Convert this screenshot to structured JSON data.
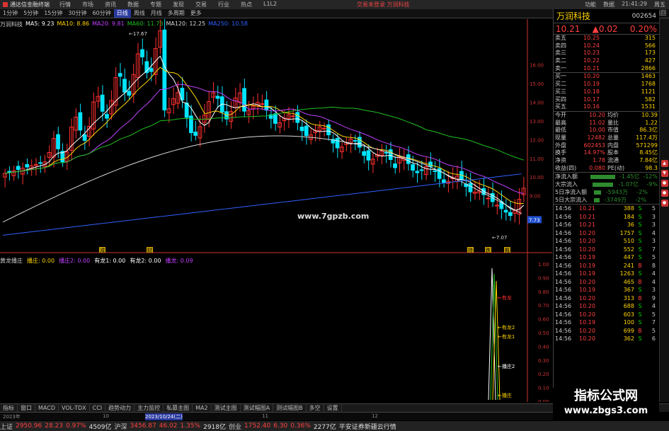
{
  "titlebar": {
    "app": "通达信金融终端",
    "menu": [
      "行情",
      "市场",
      "资讯",
      "数据",
      "专题",
      "发现",
      "交易",
      "行业",
      "热点",
      "L1L2"
    ],
    "promo": "交易未登录  万润科技",
    "right": [
      "功能",
      "数据",
      "21:41:29",
      "周五"
    ]
  },
  "toolbar": {
    "items": [
      "1分钟",
      "5分钟",
      "15分钟",
      "30分钟",
      "60分钟",
      "日线",
      "周线",
      "月线",
      "多周期",
      "更多"
    ],
    "active": "日线",
    "right": [
      "F10",
      "标记",
      "返回"
    ]
  },
  "chart": {
    "stock_label": "万润科技",
    "ma": [
      {
        "label": "MA5: 9.23",
        "color": "#ffffff"
      },
      {
        "label": "MA10: 8.86",
        "color": "#ffd400"
      },
      {
        "label": "MA20: 9.81",
        "color": "#c040ff"
      },
      {
        "label": "MA60: 11.73",
        "color": "#20c020"
      },
      {
        "label": "MA120: 12.25",
        "color": "#d8d8d8"
      },
      {
        "label": "MA250: 10.58",
        "color": "#3060ff"
      }
    ],
    "y_ticks": [
      "16.00",
      "15.00",
      "14.00",
      "13.00",
      "12.00",
      "11.00",
      "10.00",
      "9.00"
    ],
    "current_price_tag": "7.73",
    "high_label": "17.67",
    "low_label": "7.07",
    "watermark": "www.7gpzb.com",
    "signals": [
      "减",
      "财",
      "持",
      "跌",
      "概"
    ]
  },
  "osc": {
    "title": "黄龙播庄",
    "items": [
      {
        "label": "播庄: 0.00",
        "color": "#ffd400"
      },
      {
        "label": "播庄2: 0.00",
        "color": "#c040ff"
      },
      {
        "label": "有龙1: 0.00",
        "color": "#ffffff"
      },
      {
        "label": "有龙2: 0.00",
        "color": "#ffffff"
      },
      {
        "label": "播龙: 0.09",
        "color": "#c040ff"
      }
    ],
    "markers": [
      "有龙",
      "有龙2",
      "有龙1",
      "播庄2",
      "播庄"
    ],
    "y_ticks": [
      "1.00",
      "0.90",
      "0.80",
      "0.70",
      "0.60",
      "0.50",
      "0.40",
      "0.30",
      "0.20",
      "0.10",
      "0.00"
    ]
  },
  "right": {
    "name": "万润科技",
    "code": "002654",
    "price": "10.21",
    "change": "▲0.02",
    "pct": "0.20%",
    "asks": [
      {
        "l": "卖五",
        "p": "10.25",
        "v": "315"
      },
      {
        "l": "卖四",
        "p": "10.24",
        "v": "566"
      },
      {
        "l": "卖三",
        "p": "10.23",
        "v": "173"
      },
      {
        "l": "卖二",
        "p": "10.22",
        "v": "427"
      },
      {
        "l": "卖一",
        "p": "10.21",
        "v": "2866"
      }
    ],
    "bids": [
      {
        "l": "买一",
        "p": "10.20",
        "v": "1463"
      },
      {
        "l": "买二",
        "p": "10.19",
        "v": "1768"
      },
      {
        "l": "买三",
        "p": "10.18",
        "v": "1121"
      },
      {
        "l": "买四",
        "p": "10.17",
        "v": "582"
      },
      {
        "l": "买五",
        "p": "10.16",
        "v": "1531"
      }
    ],
    "stats": [
      {
        "a": "今开",
        "b": "10.20",
        "c": "均价",
        "d": "10.39"
      },
      {
        "a": "最高",
        "b": "11.02",
        "c": "量比",
        "d": "1.22"
      },
      {
        "a": "最低",
        "b": "10.00",
        "c": "市值",
        "d": "86.3亿"
      },
      {
        "a": "现量",
        "b": "12482",
        "c": "总量",
        "d": "117.4万"
      },
      {
        "a": "外盘",
        "b": "602453",
        "c": "内盘",
        "d": "571299"
      },
      {
        "a": "换手",
        "b": "14.97%",
        "c": "股本",
        "d": "8.45亿"
      },
      {
        "a": "净资",
        "b": "1.78",
        "c": "流通",
        "d": "7.84亿"
      },
      {
        "a": "收益(四)",
        "b": "0.080",
        "c": "PE(动)",
        "d": "98.3"
      }
    ],
    "flows": [
      {
        "l": "净流入额",
        "v": "-1.45亿",
        "p": "-12%",
        "w": 38
      },
      {
        "l": "大宗流入",
        "v": "-1.07亿",
        "p": "-9%",
        "w": 30
      },
      {
        "l": "5日净流入额",
        "v": "-5943万",
        "p": "-2%",
        "w": 10
      },
      {
        "l": "5日大宗流入",
        "v": "-3749万",
        "p": "-2%",
        "w": 8
      }
    ],
    "ticks": [
      {
        "t": "14:56",
        "p": "10.21",
        "v": "388",
        "f": "S",
        "n": "5"
      },
      {
        "t": "14:56",
        "p": "10.21",
        "v": "184",
        "f": "S",
        "n": "3"
      },
      {
        "t": "14:56",
        "p": "10.21",
        "v": "36",
        "f": "S",
        "n": "3"
      },
      {
        "t": "14:56",
        "p": "10.20",
        "v": "1757",
        "f": "S",
        "n": "4"
      },
      {
        "t": "14:56",
        "p": "10.20",
        "v": "510",
        "f": "S",
        "n": "3"
      },
      {
        "t": "14:56",
        "p": "10.20",
        "v": "552",
        "f": "S",
        "n": "7"
      },
      {
        "t": "14:56",
        "p": "10.19",
        "v": "447",
        "f": "S",
        "n": "5"
      },
      {
        "t": "14:56",
        "p": "10.19",
        "v": "241",
        "f": "B",
        "n": "8"
      },
      {
        "t": "14:56",
        "p": "10.19",
        "v": "1263",
        "f": "S",
        "n": "4"
      },
      {
        "t": "14:56",
        "p": "10.20",
        "v": "465",
        "f": "B",
        "n": "4"
      },
      {
        "t": "14:56",
        "p": "10.19",
        "v": "367",
        "f": "S",
        "n": "3"
      },
      {
        "t": "14:56",
        "p": "10.20",
        "v": "313",
        "f": "B",
        "n": "9"
      },
      {
        "t": "14:56",
        "p": "10.20",
        "v": "688",
        "f": "S",
        "n": "4"
      },
      {
        "t": "14:56",
        "p": "10.20",
        "v": "603",
        "f": "S",
        "n": "5"
      },
      {
        "t": "14:56",
        "p": "10.19",
        "v": "100",
        "f": "S",
        "n": "7"
      },
      {
        "t": "14:56",
        "p": "10.20",
        "v": "699",
        "f": "B",
        "n": "5"
      },
      {
        "t": "14:56",
        "p": "10.20",
        "v": "362",
        "f": "S",
        "n": "6"
      }
    ]
  },
  "bottomtabs": [
    "指标",
    "窗口",
    "MACD",
    "VOL-TDX",
    "CCI",
    "趋势动力",
    "主力监控",
    "私募主图",
    "MA2",
    "测试主图",
    "测试幅图A",
    "测试幅图B",
    "多空",
    "设置"
  ],
  "statusbar": {
    "items": [
      {
        "t": "上证",
        "c": "lbl"
      },
      {
        "t": "2950.96",
        "c": "up"
      },
      {
        "t": "28.23",
        "c": "up"
      },
      {
        "t": "0.97%",
        "c": "up"
      },
      {
        "t": "4509亿",
        "c": "w"
      },
      {
        "t": "沪深",
        "c": "lbl"
      },
      {
        "t": "3456.87",
        "c": "up"
      },
      {
        "t": "46.02",
        "c": "up"
      },
      {
        "t": "1.35%",
        "c": "up"
      },
      {
        "t": "2918亿",
        "c": "w"
      },
      {
        "t": "创业",
        "c": "lbl"
      },
      {
        "t": "1752.40",
        "c": "up"
      },
      {
        "t": "6.30",
        "c": "up"
      },
      {
        "t": "0.36%",
        "c": "up"
      },
      {
        "t": "2277亿",
        "c": "w"
      },
      {
        "t": "平安证券新疆云行情",
        "c": "w"
      }
    ]
  },
  "scaleline": {
    "dates": [
      "2023年",
      "10",
      "2023/10/24(二)",
      "11",
      "12"
    ]
  },
  "watermark": {
    "t1": "指标公式网",
    "t2": "www.zbgs3.com"
  },
  "colors": {
    "up": "#ff4040",
    "down": "#00ffff",
    "ma5": "#ffffff",
    "ma10": "#ffd400",
    "ma20": "#c040ff",
    "ma60": "#20c020",
    "ma120": "#d8d8d8",
    "ma250": "#3060ff"
  }
}
